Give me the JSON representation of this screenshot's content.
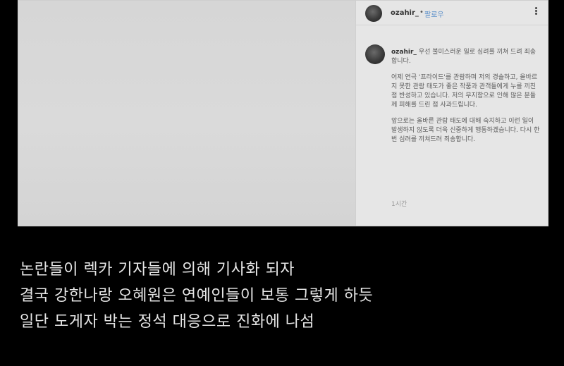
{
  "post": {
    "username": "ozahir_",
    "separator": "•",
    "follow_label": "팔로우",
    "caption": {
      "username": "ozahir_",
      "paragraphs": [
        "우선 불미스러운 일로 심려를 끼쳐 드려 죄송합니다.",
        "어제 연극 '프라이드'를 관람하며 저의 경솔하고, 올바르지 못한 관람 태도가 좋은 작품과 관객들에게 누를 끼친 점 반성하고 있습니다. 저의 무지함으로 인해 많은 분들께 피해를 드린 점 사과드립니다.",
        "앞으로는 올바른 관람 태도에 대해 숙지하고 이런 일이 발생하지 않도록 더욱 신중하게 행동하겠습니다. 다시 한번 심려를 끼쳐드려 죄송합니다."
      ],
      "time": "1시간"
    }
  },
  "subtitles": [
    "논란들이 렉카 기자들에 의해 기사화 되자",
    "결국 강한나랑 오혜원은 연예인들이 보통 그렇게 하듯",
    "일단 도게자 박는 정석 대응으로 진화에 나섬"
  ]
}
